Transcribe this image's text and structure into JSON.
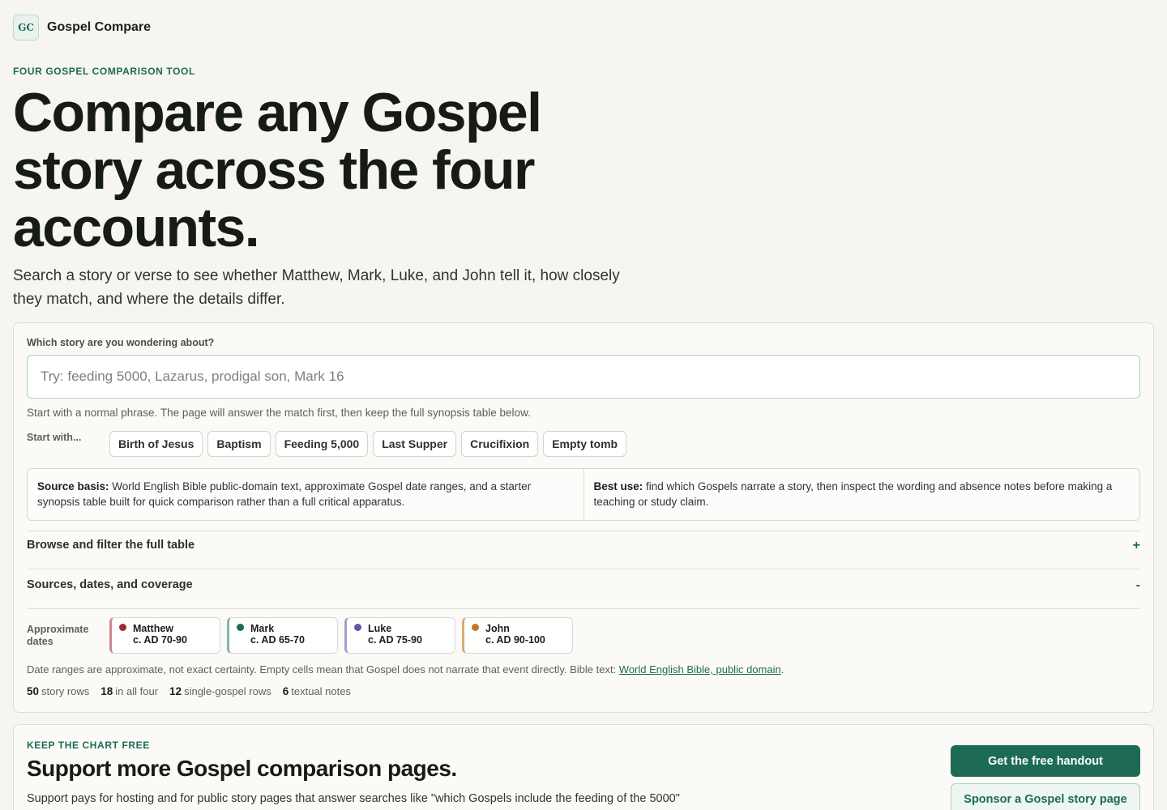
{
  "header": {
    "logo": "GC",
    "brand": "Gospel Compare"
  },
  "hero": {
    "eyebrow": "FOUR GOSPEL COMPARISON TOOL",
    "title": "Compare any Gospel story across the four accounts.",
    "subtitle": "Search a story or verse to see whether Matthew, Mark, Luke, and John tell it, how closely they match, and where the details differ."
  },
  "search": {
    "label": "Which story are you wondering about?",
    "placeholder": "Try: feeding 5000, Lazarus, prodigal son, Mark 16",
    "value": "",
    "hint": "Start with a normal phrase. The page will answer the match first, then keep the full synopsis table below.",
    "start_label": "Start with...",
    "chips": [
      "Birth of Jesus",
      "Baptism",
      "Feeding 5,000",
      "Last Supper",
      "Crucifixion",
      "Empty tomb"
    ]
  },
  "info": {
    "source_label": "Source basis:",
    "source_text": " World English Bible public-domain text, approximate Gospel date ranges, and a starter synopsis table built for quick comparison rather than a full critical apparatus.",
    "use_label": "Best use:",
    "use_text": " find which Gospels narrate a story, then inspect the wording and absence notes before making a teaching or study claim."
  },
  "accordions": [
    {
      "label": "Browse and filter the full table",
      "sign": "+"
    },
    {
      "label": "Sources, dates, and coverage",
      "sign": "-"
    }
  ],
  "dates": {
    "label": "Approximate dates",
    "gospels": [
      {
        "name": "Matthew",
        "range": "c. AD 70-90",
        "color": "#9b2d33"
      },
      {
        "name": "Mark",
        "range": "c. AD 65-70",
        "color": "#1d6b55"
      },
      {
        "name": "Luke",
        "range": "c. AD 75-90",
        "color": "#6a54a8"
      },
      {
        "name": "John",
        "range": "c. AD 90-100",
        "color": "#c0792a"
      }
    ],
    "note": "Date ranges are approximate, not exact certainty. Empty cells mean that Gospel does not narrate that event directly. Bible text: ",
    "link": "World English Bible, public domain",
    "note_end": "."
  },
  "stats": [
    {
      "count": "50",
      "label": "story rows"
    },
    {
      "count": "18",
      "label": "in all four"
    },
    {
      "count": "12",
      "label": "single-gospel rows"
    },
    {
      "count": "6",
      "label": "textual notes"
    }
  ],
  "support": {
    "eyebrow": "KEEP THE CHART FREE",
    "title": "Support more Gospel comparison pages.",
    "text": "Support pays for hosting and for public story pages that answer searches like \"which Gospels include the feeding of the 5000\" with clear, shareable comparisons.",
    "primary": "Get the free handout",
    "secondary": "Sponsor a Gospel story page"
  }
}
